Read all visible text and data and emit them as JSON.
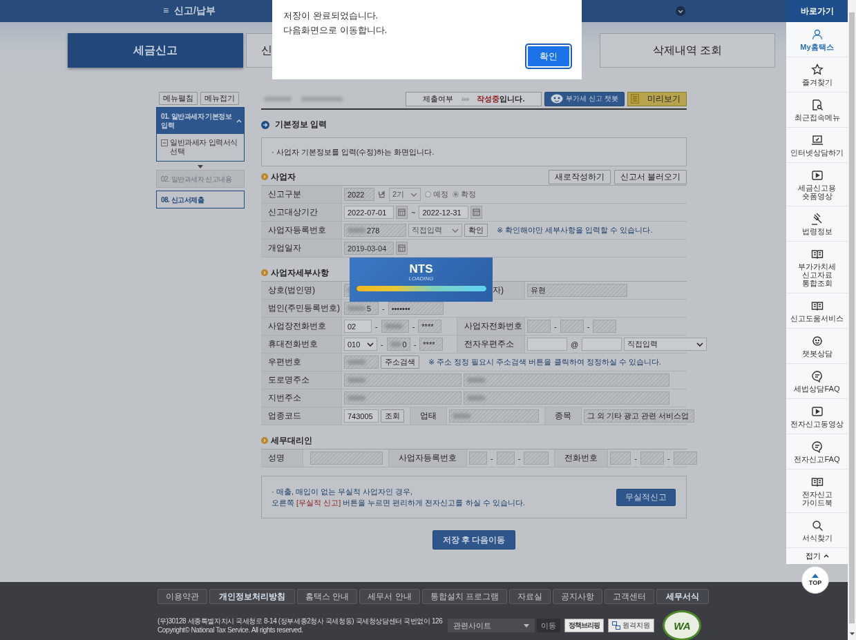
{
  "top_bar": {
    "menu_icon": "≡",
    "menu_label": "신고/납부"
  },
  "tabs": [
    {
      "label": "세금신고",
      "selected": true
    },
    {
      "label": "신",
      "selected": false
    },
    {
      "label": "삭제내역 조회",
      "selected": false
    }
  ],
  "dialog": {
    "lines": [
      "저장이 완료되었습니다.",
      "다음화면으로 이동합니다."
    ],
    "button": "확인"
  },
  "side_menu": {
    "buttons": [
      "메뉴펼침",
      "메뉴접기"
    ],
    "steps": [
      {
        "label": "01. 일반과세자 기본정보\n입력",
        "selected": true,
        "disabled": false,
        "expanded": true,
        "children": [
          {
            "label": "일반과세자 입력서식\n선택"
          }
        ]
      },
      {
        "label": "02. 일반과세자 신고내용",
        "selected": false,
        "disabled": true
      },
      {
        "label": "08. 신고서제출",
        "selected": false,
        "disabled": false
      }
    ]
  },
  "status": {
    "label": "제출여부",
    "arrows": "››››",
    "value": "작성중",
    "suffix": "입니다."
  },
  "chatbot_button": "부가세 신고 챗봇",
  "preview_button": "미리보기",
  "basic_info": {
    "title": "기본정보 입력",
    "description": "· 사업자 기본정보를 입력(수정)하는 화면입니다."
  },
  "sections": [
    {
      "title": "사업자",
      "buttons": [
        "새로작성하기",
        "신고서 불러오기"
      ],
      "rows": [
        {
          "cells": [
            {
              "label": "신고구분",
              "items": [
                {
                  "kind": "field",
                  "value": "2022",
                  "readonly": true,
                  "blurred": false
                },
                {
                  "kind": "text",
                  "text": "년"
                },
                {
                  "kind": "select",
                  "value": "2기",
                  "disabled": true
                },
                {
                  "kind": "radio",
                  "label": "예정",
                  "checked": false
                },
                {
                  "kind": "radio",
                  "label": "확정",
                  "checked": true
                }
              ]
            }
          ]
        },
        {
          "cells": [
            {
              "label": "신고대상기간",
              "items": [
                {
                  "kind": "field",
                  "value": "2022-07-01",
                  "readonly": false,
                  "blurred": false
                },
                {
                  "kind": "calendar"
                },
                {
                  "kind": "text",
                  "text": "~"
                },
                {
                  "kind": "field",
                  "value": "2022-12-31",
                  "readonly": false,
                  "blurred": false
                },
                {
                  "kind": "calendar"
                }
              ]
            }
          ]
        },
        {
          "cells": [
            {
              "label": "사업자등록번호",
              "items": [
                {
                  "kind": "field",
                  "value": "278",
                  "readonly": true,
                  "blurred": true
                },
                {
                  "kind": "select",
                  "value": "직접입력",
                  "disabled": true
                },
                {
                  "kind": "button",
                  "label": "확인"
                },
                {
                  "kind": "note",
                  "text": "※ 확인해야만 세부사항을 입력할 수 있습니다."
                }
              ]
            }
          ]
        },
        {
          "cells": [
            {
              "label": "개업일자",
              "items": [
                {
                  "kind": "field",
                  "value": "2019-03-04",
                  "readonly": true,
                  "blurred": false
                },
                {
                  "kind": "calendar"
                }
              ]
            }
          ]
        }
      ]
    },
    {
      "title": "사업자세부사항",
      "rows": [
        {
          "cells": [
            {
              "label": "상호(법인명)",
              "items": [
                {
                  "kind": "field",
                  "readonly": true,
                  "blurred": true
                }
              ]
            },
            {
              "label": "자)",
              "items": [
                {
                  "kind": "field",
                  "value": "유현",
                  "readonly": true,
                  "blurred": false
                }
              ]
            }
          ]
        },
        {
          "cells": [
            {
              "label": "법인(주민등록번호)",
              "items": [
                {
                  "kind": "field",
                  "value": "5",
                  "readonly": true,
                  "blurred": true
                },
                {
                  "kind": "text",
                  "text": "-"
                },
                {
                  "kind": "field",
                  "value": "•••••••",
                  "readonly": true,
                  "blurred": false
                }
              ]
            }
          ]
        },
        {
          "cells": [
            {
              "label": "사업장전화번호",
              "items": [
                {
                  "kind": "field",
                  "value": "02",
                  "readonly": false,
                  "blurred": false
                },
                {
                  "kind": "text",
                  "text": "-"
                },
                {
                  "kind": "field",
                  "readonly": true,
                  "blurred": true
                },
                {
                  "kind": "text",
                  "text": "-"
                },
                {
                  "kind": "field",
                  "value": "****",
                  "readonly": true,
                  "blurred": false
                }
              ]
            },
            {
              "label": "사업자전화번호",
              "items": [
                {
                  "kind": "field",
                  "readonly": true,
                  "blurred": false
                },
                {
                  "kind": "text",
                  "text": "-"
                },
                {
                  "kind": "field",
                  "readonly": true,
                  "blurred": false
                },
                {
                  "kind": "text",
                  "text": "-"
                },
                {
                  "kind": "field",
                  "readonly": true,
                  "blurred": false
                }
              ]
            }
          ]
        },
        {
          "cells": [
            {
              "label": "휴대전화번호",
              "items": [
                {
                  "kind": "select",
                  "value": "010",
                  "disabled": false
                },
                {
                  "kind": "text",
                  "text": "-"
                },
                {
                  "kind": "field",
                  "value": "0",
                  "readonly": true,
                  "blurred": true
                },
                {
                  "kind": "text",
                  "text": "-"
                },
                {
                  "kind": "field",
                  "value": "****",
                  "readonly": true,
                  "blurred": false
                }
              ]
            },
            {
              "label": "전자우편주소",
              "items": [
                {
                  "kind": "field",
                  "readonly": false,
                  "blurred": false
                },
                {
                  "kind": "text",
                  "text": "@"
                },
                {
                  "kind": "field",
                  "readonly": false,
                  "blurred": false
                },
                {
                  "kind": "select",
                  "value": "직접입력",
                  "disabled": false
                }
              ]
            }
          ]
        },
        {
          "cells": [
            {
              "label": "우편번호",
              "items": [
                {
                  "kind": "field",
                  "readonly": true,
                  "blurred": true
                },
                {
                  "kind": "button",
                  "label": "주소검색"
                },
                {
                  "kind": "note",
                  "text": "※ 주소 정정 필요시 주소검색 버튼을 클릭하여 정정하실 수 있습니다."
                }
              ]
            }
          ]
        },
        {
          "cells": [
            {
              "label": "도로명주소",
              "items": [
                {
                  "kind": "field",
                  "readonly": true,
                  "blurred": true
                },
                {
                  "kind": "field",
                  "readonly": true,
                  "blurred": true
                }
              ]
            }
          ]
        },
        {
          "cells": [
            {
              "label": "지번주소",
              "items": [
                {
                  "kind": "field",
                  "readonly": true,
                  "blurred": true
                },
                {
                  "kind": "field",
                  "readonly": true,
                  "blurred": true
                }
              ]
            }
          ]
        },
        {
          "cells": [
            {
              "label": "업종코드",
              "items": [
                {
                  "kind": "field",
                  "value": "743005",
                  "readonly": false,
                  "blurred": false
                },
                {
                  "kind": "button",
                  "label": "조회"
                }
              ]
            },
            {
              "label": "업태",
              "items": [
                {
                  "kind": "field",
                  "readonly": true,
                  "blurred": true
                }
              ]
            },
            {
              "label": "종목",
              "items": [
                {
                  "kind": "field",
                  "value": "그 외 기타 광고 관련 서비스업",
                  "readonly": true,
                  "blurred": false
                }
              ]
            }
          ]
        }
      ]
    },
    {
      "title": "세무대리인",
      "rows": [
        {
          "cells": [
            {
              "label": "성명",
              "items": [
                {
                  "kind": "field",
                  "readonly": true,
                  "blurred": false
                }
              ]
            },
            {
              "label": "사업자등록번호",
              "items": [
                {
                  "kind": "field",
                  "readonly": true,
                  "blurred": false
                },
                {
                  "kind": "text",
                  "text": "-"
                },
                {
                  "kind": "field",
                  "readonly": true,
                  "blurred": false
                },
                {
                  "kind": "text",
                  "text": "-"
                },
                {
                  "kind": "field",
                  "readonly": true,
                  "blurred": false
                }
              ]
            },
            {
              "label": "전화번호",
              "items": [
                {
                  "kind": "field",
                  "readonly": true,
                  "blurred": false
                },
                {
                  "kind": "text",
                  "text": "-"
                },
                {
                  "kind": "field",
                  "readonly": true,
                  "blurred": false
                },
                {
                  "kind": "text",
                  "text": "-"
                },
                {
                  "kind": "field",
                  "readonly": true,
                  "blurred": false
                }
              ]
            }
          ]
        }
      ]
    }
  ],
  "notice": {
    "bullet": "·",
    "line1": "매출, 매입이 없는 무실적 사업자인 경우,",
    "line2_before": "오른쪽 ",
    "line2_highlight": "[무실적 신고]",
    "line2_after": " 버튼을 누르면 편리하게 전자신고를 하실 수 있습니다.",
    "button": "무실적신고"
  },
  "save_button": "저장 후 다음이동",
  "loading": {
    "title": "NTS",
    "subtitle": "LOADING",
    "level": 1
  },
  "quick_menu": {
    "title": "바로가기",
    "items": [
      {
        "label": "My홈택스",
        "selected": true
      },
      {
        "label": "즐겨찾기",
        "selected": false
      },
      {
        "label": "최근접속메뉴",
        "selected": false
      },
      {
        "label": "인터넷상담하기",
        "selected": false
      },
      {
        "label": "세금신고용\n숏폼영상",
        "selected": false
      },
      {
        "label": "법령정보",
        "selected": false
      },
      {
        "label": "부가가치세\n신고자료\n통합조회",
        "selected": false
      },
      {
        "label": "신고도움서비스",
        "selected": false
      },
      {
        "label": "챗봇상담",
        "selected": false
      },
      {
        "label": "세법상담FAQ",
        "selected": false
      },
      {
        "label": "전자신고동영상",
        "selected": false
      },
      {
        "label": "전자신고FAQ",
        "selected": false
      },
      {
        "label": "전자신고\n가이드북",
        "selected": false
      },
      {
        "label": "서식찾기",
        "selected": false
      }
    ],
    "collapse": "접기",
    "top_button": "TOP"
  },
  "footer": {
    "links": [
      {
        "label": "이용약관",
        "emphasized": false
      },
      {
        "label": "개인정보처리방침",
        "emphasized": true
      },
      {
        "label": "홈택스 안내",
        "emphasized": false
      },
      {
        "label": "세무서 안내",
        "emphasized": false
      },
      {
        "label": "통합설치 프로그램",
        "emphasized": false
      },
      {
        "label": "자료실",
        "emphasized": false
      },
      {
        "label": "공지사항",
        "emphasized": false
      },
      {
        "label": "고객센터",
        "emphasized": false
      },
      {
        "label": "세무서식",
        "emphasized": true
      }
    ],
    "address": "(우)30128 세종특별자치시 국세청로 8-14 (정부세종2청사 국세청동) 국세청상담센터 국번없이 126",
    "copyright": "Copyright© National Tax Service. All rights reserved.",
    "related_select": "관련사이트",
    "go_button": "이동",
    "briefing_button": "정책브리핑",
    "remote_button": "원격지원",
    "badge": "WA"
  }
}
